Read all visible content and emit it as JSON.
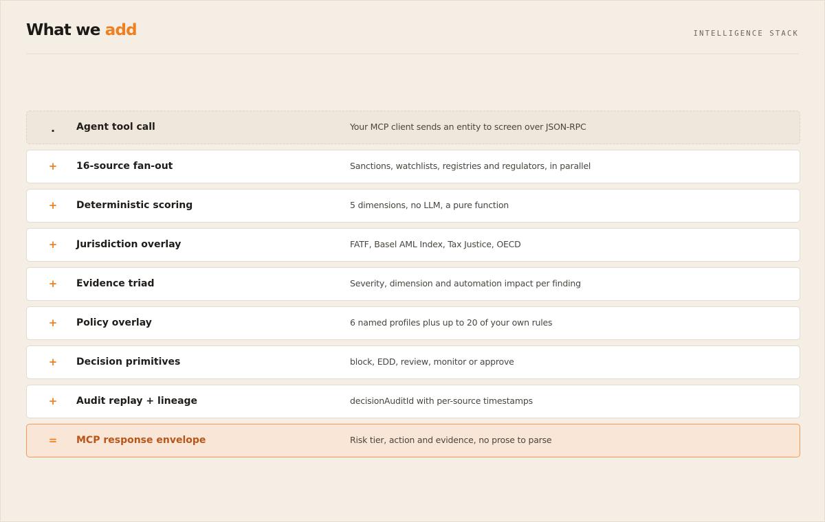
{
  "header": {
    "title_prefix": "What we ",
    "title_accent": "add",
    "eyebrow": "INTELLIGENCE STACK"
  },
  "colors": {
    "accent": "#f0801f",
    "result_text": "#b8561a",
    "background": "#f5eee4"
  },
  "stack": [
    {
      "marker": ".",
      "label": "Agent tool call",
      "description": "Your MCP client sends an entity to screen over JSON-RPC",
      "kind": "start"
    },
    {
      "marker": "+",
      "label": "16-source fan-out",
      "description": "Sanctions, watchlists, registries and regulators, in parallel",
      "kind": "layer"
    },
    {
      "marker": "+",
      "label": "Deterministic scoring",
      "description": "5 dimensions, no LLM, a pure function",
      "kind": "layer"
    },
    {
      "marker": "+",
      "label": "Jurisdiction overlay",
      "description": "FATF, Basel AML Index, Tax Justice, OECD",
      "kind": "layer"
    },
    {
      "marker": "+",
      "label": "Evidence triad",
      "description": "Severity, dimension and automation impact per finding",
      "kind": "layer"
    },
    {
      "marker": "+",
      "label": "Policy overlay",
      "description": "6 named profiles plus up to 20 of your own rules",
      "kind": "layer"
    },
    {
      "marker": "+",
      "label": "Decision primitives",
      "description": "block, EDD, review, monitor or approve",
      "kind": "layer"
    },
    {
      "marker": "+",
      "label": "Audit replay + lineage",
      "description": "decisionAuditId with per-source timestamps",
      "kind": "layer"
    },
    {
      "marker": "=",
      "label": "MCP response envelope",
      "description": "Risk tier, action and evidence, no prose to parse",
      "kind": "result"
    }
  ]
}
